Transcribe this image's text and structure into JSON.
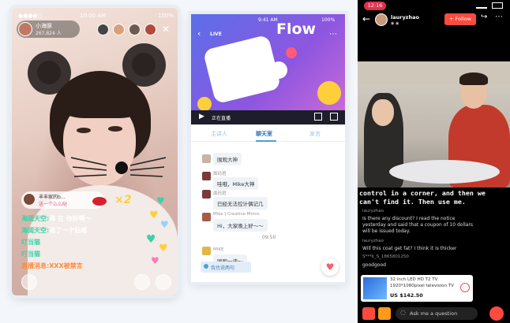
{
  "phone1": {
    "status": {
      "signal": "●●●●○ ",
      "time": "10:00 AM",
      "battery": "100%"
    },
    "host": {
      "name": "小海豚",
      "count": "267,824 人"
    },
    "gift_banner": {
      "sender": "丰丰家的b...",
      "text": "送一个么么哒",
      "multiplier": "×2"
    },
    "chat": [
      {
        "user": "海阔天空:",
        "text": "海 在 你好啊～",
        "color": "#3ad1a8"
      },
      {
        "user": "海阔天空:",
        "text": "送了一个钻戒",
        "color": "#3ad1a8"
      },
      {
        "user": "叮当猫",
        "text": "",
        "color": "#3ad1a8"
      },
      {
        "user": "叮当猫",
        "text": "",
        "color": "#3ad1a8"
      },
      {
        "user": "直播消息:",
        "text": "XXX被禁言",
        "color": "#ff8a3a"
      }
    ],
    "colors": {
      "chat_name": "#3ad1a8",
      "system": "#ff8a3a"
    }
  },
  "phone2": {
    "status": {
      "time": "9:41 AM",
      "battery": "100%"
    },
    "video_title": "Flow",
    "video_caption": "LIVE",
    "playing_label": "正在直播",
    "tabs": [
      "主讲人",
      "聊天室",
      "发言"
    ],
    "messages": [
      {
        "name": "",
        "text": "围观大神"
      },
      {
        "name": "面码君",
        "text": "哇哦，Mike大神"
      },
      {
        "name": "面码君",
        "text": "已经无法控计偶记几"
      },
      {
        "name": "Mike | Creative Mimic",
        "text": "Hi，大家晚上好～～"
      },
      {
        "name": "MIKE",
        "text": "围观一波～"
      }
    ],
    "timestamp": "09:50",
    "input_placeholder": "我也说两句",
    "accent": "#4a9fe0"
  },
  "phone3": {
    "status": {
      "time": "12:16"
    },
    "user": "lauryzhao",
    "follow_label": "+ Follow",
    "subtitle": [
      "control in a corner, and then we",
      "can't find it. Then use me."
    ],
    "comments": [
      {
        "name": "lauryzhao",
        "text": "Is there any discount? I read the notice yesterday and said that a coupon of 10 dollars will be issued today."
      },
      {
        "name": "lauryzhao",
        "text": "Will this coat get fat? I think it is thicker"
      },
      {
        "name": "S***k_S_1865801250",
        "text": "goodgood"
      }
    ],
    "product": {
      "title": "32 inch LED HD T2 TV",
      "subtitle": "1920*1080pixel television TV",
      "price": "US $142.50"
    },
    "ask_placeholder": "Ask me a question",
    "accent": "#ff4a3d"
  }
}
